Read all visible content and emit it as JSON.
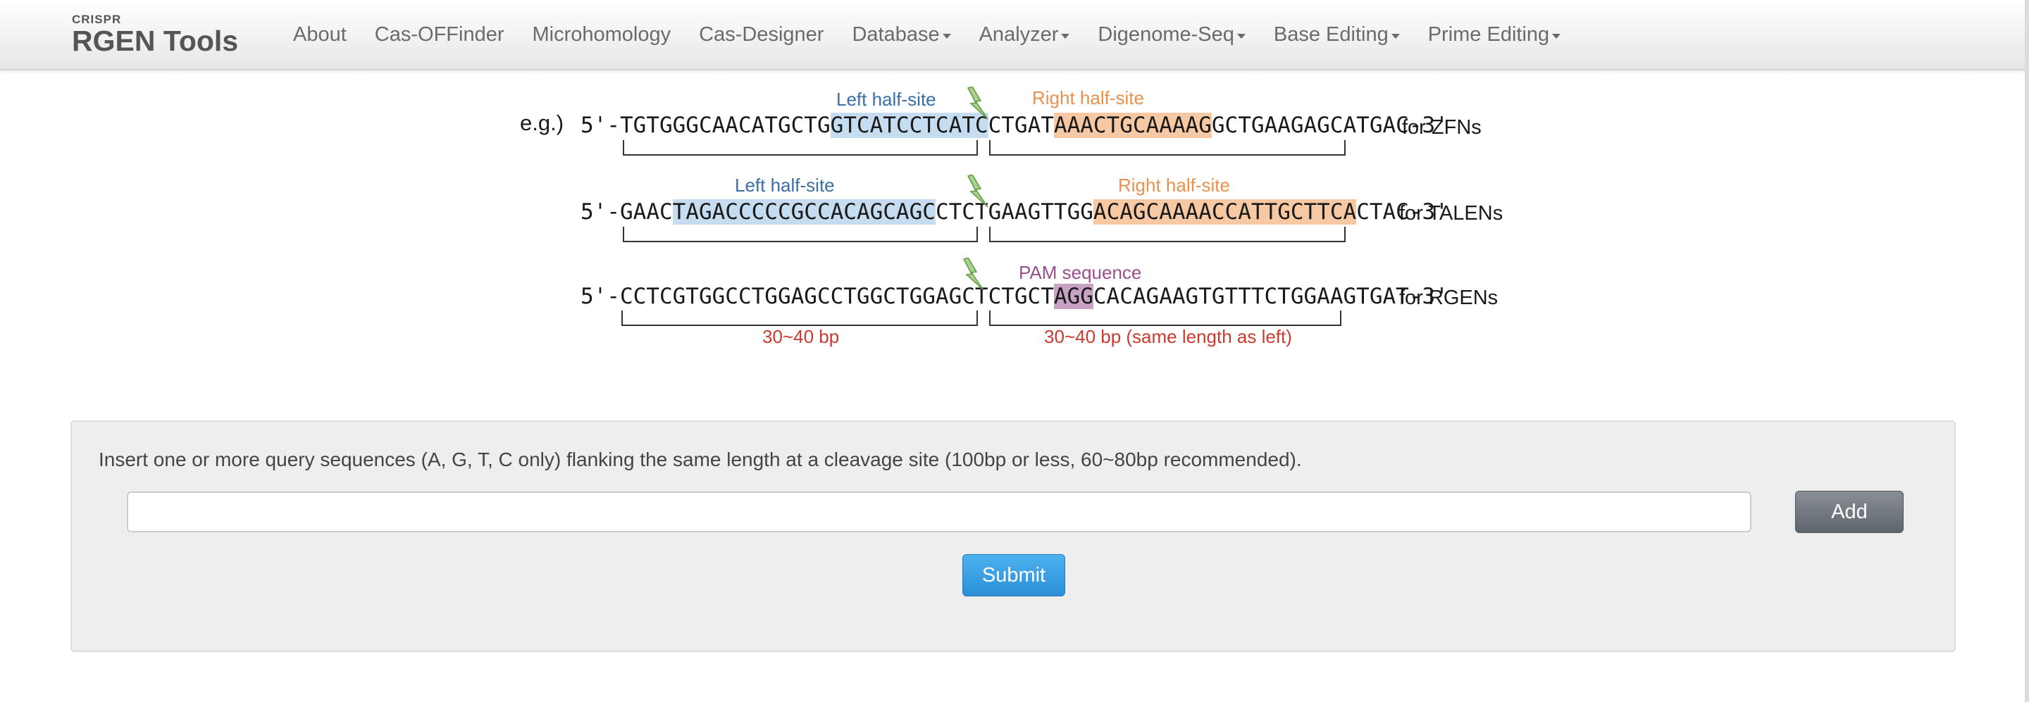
{
  "brand": {
    "small": "CRISPR",
    "big": "RGEN Tools"
  },
  "nav": {
    "items": [
      {
        "label": "About",
        "dropdown": false
      },
      {
        "label": "Cas-OFFinder",
        "dropdown": false
      },
      {
        "label": "Microhomology",
        "dropdown": false
      },
      {
        "label": "Cas-Designer",
        "dropdown": false
      },
      {
        "label": "Database",
        "dropdown": true
      },
      {
        "label": "Analyzer",
        "dropdown": true
      },
      {
        "label": "Digenome-Seq",
        "dropdown": true
      },
      {
        "label": "Base Editing",
        "dropdown": true
      },
      {
        "label": "Prime Editing",
        "dropdown": true
      }
    ]
  },
  "examples": {
    "eg_label": "e.g.)",
    "zfn": {
      "left_label": "Left half-site",
      "right_label": "Right half-site",
      "seq_prefix": "5'-TGTGGGCAACATGCTG",
      "seq_left": "GTCATCCTCATC",
      "seq_mid": "CTGAT",
      "seq_right": "AAACTGCAAAAG",
      "seq_suffix": "GCTGAAGAGCATGAC-3'",
      "suffix_label": "for ZFNs"
    },
    "talen": {
      "left_label": "Left half-site",
      "right_label": "Right half-site",
      "seq_prefix": "5'-GAAC",
      "seq_left": "TAGACCCCCGCCACAGCAGC",
      "seq_mid": "CTCTGAAGTTGG",
      "seq_right": "ACAGCAAAACCATTGCTTCA",
      "seq_suffix": "CTAC-3'",
      "suffix_label": "for TALENs"
    },
    "rgen": {
      "pam_label": "PAM sequence",
      "seq_prefix": "5'-CCTCGTGGCCTGGAGCCTGGCTGGAGCTCTGCT",
      "seq_pam": "AGG",
      "seq_suffix": "CACAGAAGTGTTTCTGGAAGTGAT-3'",
      "suffix_label": "for RGENs",
      "left_length": "30~40 bp",
      "right_length": "30~40 bp (same length as left)"
    }
  },
  "form": {
    "instructions": "Insert one or more query sequences (A, G, T, C only) flanking the same length at a cleavage site (100bp or less, 60~80bp recommended).",
    "query_value": "",
    "add_label": "Add",
    "submit_label": "Submit"
  },
  "colors": {
    "left_highlight": "#c6dcf0",
    "right_highlight": "#f6c8a4",
    "pam_highlight": "#c7a2c3",
    "submit": "#2a8fd6",
    "add": "#6b7178"
  }
}
